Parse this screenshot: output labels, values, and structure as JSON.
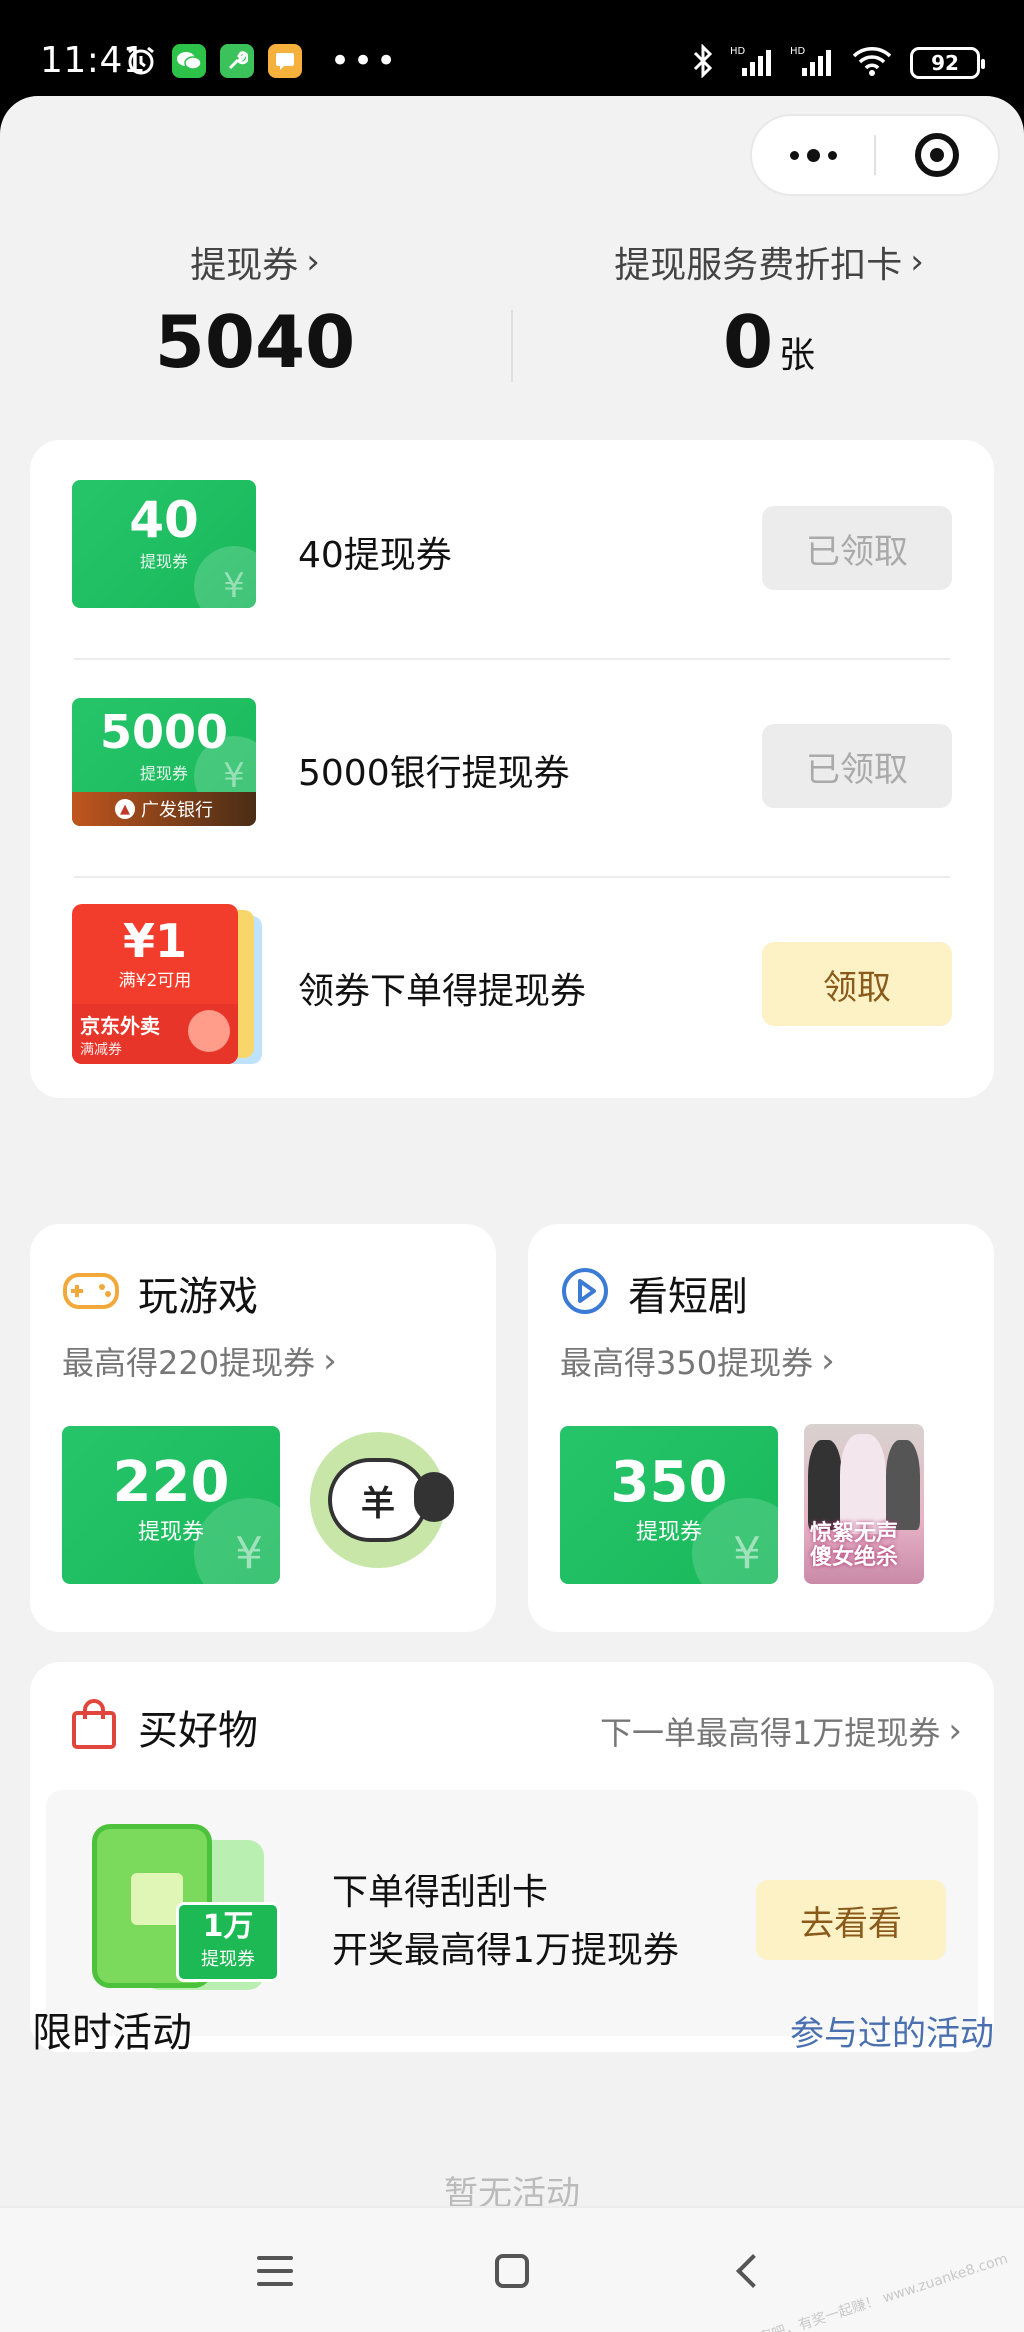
{
  "status_bar": {
    "time": "11:41",
    "battery": "92",
    "icons_left": [
      "alarm-icon",
      "wechat-icon",
      "tool-app-icon",
      "message-app-icon"
    ],
    "icons_right": [
      "bluetooth-icon",
      "signal-hd-icon",
      "signal-hd-icon",
      "wifi-icon",
      "battery-icon"
    ]
  },
  "summary": {
    "left": {
      "label": "提现券",
      "value": "5040"
    },
    "right": {
      "label": "提现服务费折扣卡",
      "value": "0",
      "unit": "张"
    }
  },
  "coupons": [
    {
      "ticket_value": "40",
      "ticket_sub": "提现券",
      "title": "40提现券",
      "button": "已领取",
      "state": "claimed"
    },
    {
      "ticket_value": "5000",
      "ticket_sub": "提现券",
      "bank": "广发银行",
      "title": "5000银行提现券",
      "button": "已领取",
      "state": "claimed"
    },
    {
      "ticket_value": "¥1",
      "ticket_sub": "满¥2可用",
      "brand": "京东外卖",
      "brand_sub": "满减券",
      "title": "领券下单得提现券",
      "button": "领取",
      "state": "available"
    }
  ],
  "activities": [
    {
      "title": "玩游戏",
      "subtitle": "最高得220提现券",
      "ticket_value": "220",
      "ticket_sub": "提现券",
      "icon": "gamepad-icon",
      "thumb_text": "羊"
    },
    {
      "title": "看短剧",
      "subtitle": "最高得350提现券",
      "ticket_value": "350",
      "ticket_sub": "提现券",
      "icon": "play-icon",
      "poster_text": "惊絮无声 傻女绝杀"
    }
  ],
  "shopping": {
    "title": "买好物",
    "link": "下一单最高得1万提现券",
    "line1": "下单得刮刮卡",
    "line2": "开奖最高得1万提现券",
    "badge_value": "1万",
    "badge_sub": "提现券",
    "button": "去看看"
  },
  "limited": {
    "title": "限时活动",
    "link": "参与过的活动",
    "empty": "暂无活动"
  },
  "watermark": "赚客吧，有奖一起赚！ www.zuanke8.com",
  "colors": {
    "green": "#1db954",
    "claim_bg": "#fdf1c6",
    "claim_text": "#8a5a1a",
    "link_blue": "#4a70b0",
    "red": "#f23d2c"
  }
}
